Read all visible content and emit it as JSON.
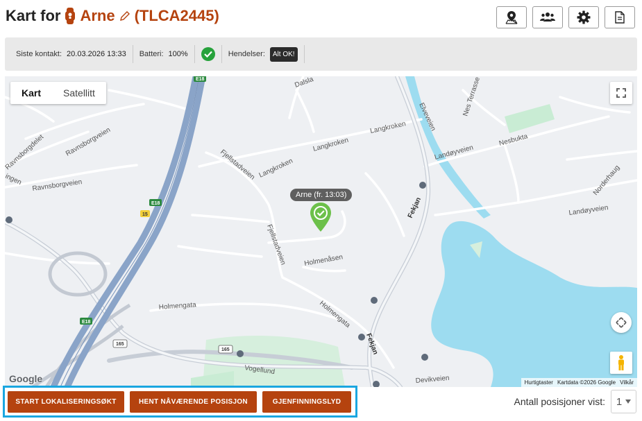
{
  "header": {
    "prefix": "Kart for",
    "device_name": "Arne",
    "device_code": "(TLCA2445)",
    "toolbar": [
      {
        "icon": "map-pin-icon",
        "name": "map-button"
      },
      {
        "icon": "users-icon",
        "name": "contacts-button"
      },
      {
        "icon": "gear-icon",
        "name": "settings-button"
      },
      {
        "icon": "document-icon",
        "name": "report-button"
      }
    ]
  },
  "status": {
    "last_contact_label": "Siste kontakt:",
    "last_contact_value": "20.03.2026 13:33",
    "battery_label": "Batteri:",
    "battery_value": "100%",
    "events_label": "Hendelser:",
    "events_value": "Alt OK!"
  },
  "map": {
    "type_map": "Kart",
    "type_satellite": "Satellitt",
    "marker_label": "Arne (fr. 13:03)",
    "google": "Google",
    "footer": [
      "Hurtigtaster",
      "Kartdata ©2026 Google",
      "Vilkår"
    ],
    "streets": {
      "langkroken1": "Langkroken",
      "langkroken2": "Langkroken",
      "langkroken3": "Langkroken",
      "fjellstadveien1": "Fjellstadveien",
      "fjellstadveien2": "Fjellstadveien",
      "ravnsborgveien1": "Ravnsborgveien",
      "ravnsborgveien2": "Ravnsborgveien",
      "ravnsborgdelet": "Ravnsborgdelet",
      "holmenasen": "Holmenåsen",
      "holmengata1": "Holmengata",
      "holmengata2": "Holmengata",
      "fekjan1": "Fekjan",
      "fekjan2": "Fekjan",
      "vogellund": "Vogellund",
      "devikveien": "Devikveien",
      "landoyveien1": "Landøyveien",
      "landoyveien2": "Landøyveien",
      "elveveien": "Elveveien",
      "nesterrasse": "Nes Terrasse",
      "nesbukta": "Nesbukta",
      "norderhaug": "Norderhaug",
      "dalsla": "Dalsla",
      "ingen": "ingen",
      "e18a": "E18",
      "e18b": "E18",
      "e18c": "E18",
      "r165a": "165",
      "r165b": "165",
      "r15": "15"
    }
  },
  "actions": {
    "start_search": "START LOKALISERINGSØKT",
    "get_position": "HENT NÅVÆRENDE POSISJON",
    "recovery_sound": "GJENFINNINGSLYD"
  },
  "positions": {
    "label": "Antall posisjoner vist:",
    "value": "1"
  },
  "colors": {
    "accent": "#b5430f",
    "highlight_border": "#1aa6e0",
    "ok_green": "#27a23c",
    "water": "#9ddcf0",
    "park": "#c9ecd4",
    "highway": "#8aa4c8"
  }
}
